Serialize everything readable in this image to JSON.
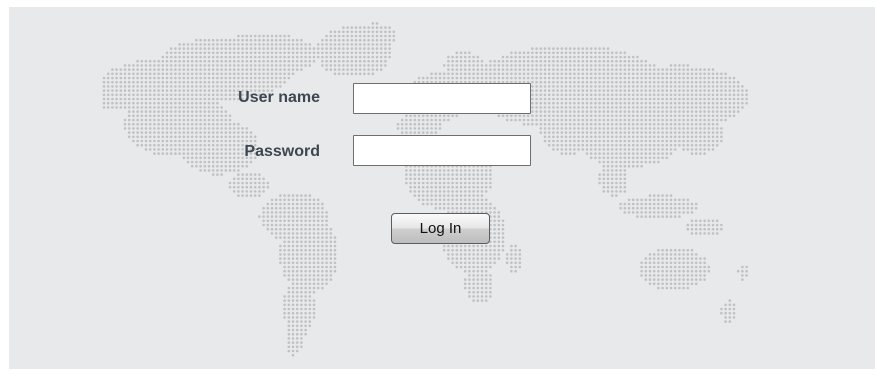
{
  "login_form": {
    "username_label": "User name",
    "username_value": "",
    "password_label": "Password",
    "password_value": "",
    "login_button_label": "Log In"
  },
  "background": {
    "panel_color": "#e8e9ea",
    "dot_color": "#bfc1c3",
    "decoration": "world-map-dots"
  }
}
